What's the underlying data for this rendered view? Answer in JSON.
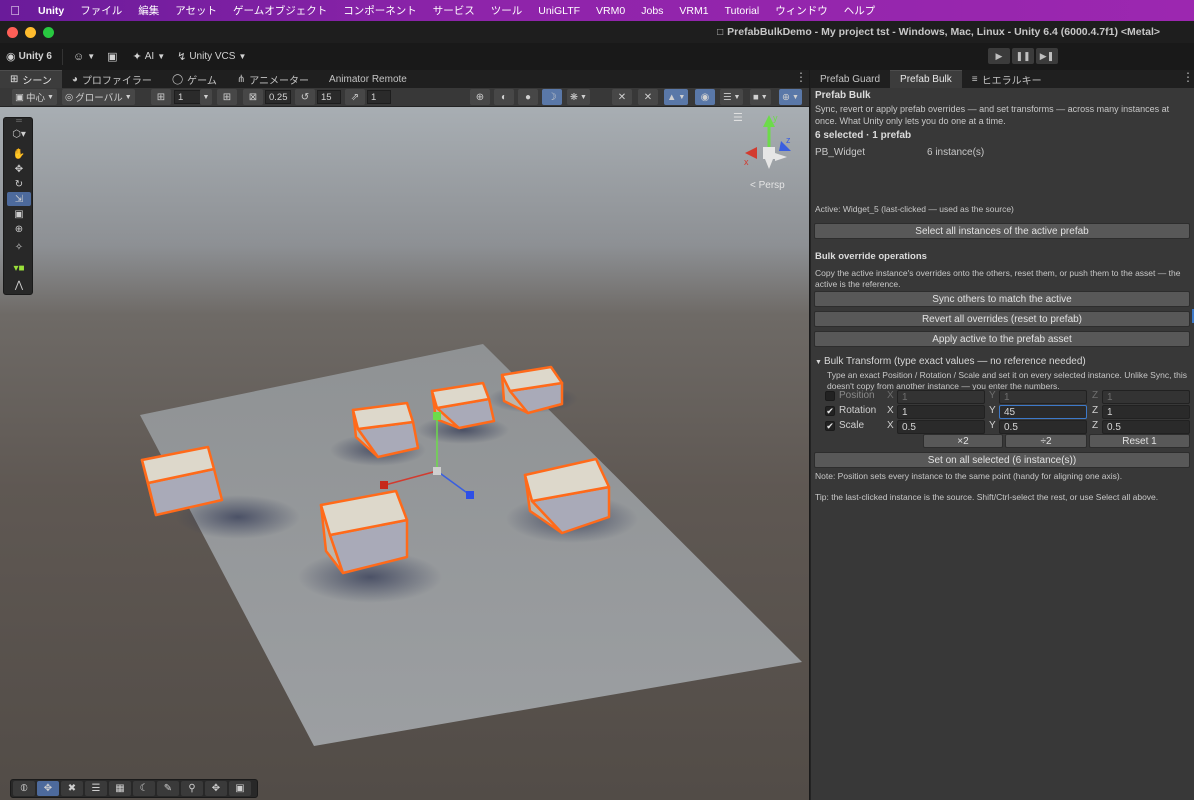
{
  "menubar": {
    "items": [
      "Unity",
      "ファイル",
      "編集",
      "アセット",
      "ゲームオブジェクト",
      "コンポーネント",
      "サービス",
      "ツール",
      "UniGLTF",
      "VRM0",
      "Jobs",
      "VRM1",
      "Tutorial",
      "ウィンドウ",
      "ヘルプ"
    ]
  },
  "window": {
    "title": "PrefabBulkDemo - My project tst - Windows, Mac, Linux - Unity 6.4 (6000.4.7f1) <Metal>"
  },
  "toolbar": {
    "account_label": "Unity 6",
    "ai_label": "AI",
    "vcs_label": "Unity VCS"
  },
  "scene_tabs": [
    "シーン",
    "プロファイラー",
    "ゲーム",
    "アニメーター",
    "Animator Remote"
  ],
  "panel_tabs": [
    "Prefab Guard",
    "Prefab Bulk",
    "ヒエラルキー"
  ],
  "scene_toolbar": {
    "pivot_label": "中心",
    "space_label": "グローバル",
    "grid_value": "1",
    "scale_snap": "0.25",
    "rotate_snap": "15",
    "increment_snap": "1"
  },
  "scene": {
    "persp_label": "< Persp",
    "gizmo_axes": {
      "x": "x",
      "y": "y",
      "z": "z"
    }
  },
  "panel": {
    "title": "Prefab Bulk",
    "description": "Sync, revert or apply prefab overrides — and set transforms — across many instances at once. What Unity only lets you do one at a time.",
    "selection_summary": "6 selected  ·  1 prefab",
    "prefab_row": {
      "name": "PB_Widget",
      "count": "6 instance(s)"
    },
    "active_note": "Active: Widget_5   (last-clicked — used as the source)",
    "select_all_button": "Select all instances of the active prefab",
    "overrides_heading": "Bulk override operations",
    "overrides_description": "Copy the active instance's overrides onto the others, reset them, or push them to the asset — the active is the reference.",
    "sync_button": "Sync others to match the active",
    "revert_button": "Revert all overrides  (reset to prefab)",
    "apply_button": "Apply active to the prefab asset",
    "bulk_transform_heading": "Bulk Transform  (type exact values — no reference needed)",
    "bulk_transform_description": "Type an exact Position / Rotation / Scale and set it on every selected instance. Unlike Sync, this doesn't copy from another instance — you enter the numbers.",
    "fields": [
      {
        "label": "Position",
        "checked": false,
        "x": "1",
        "y": "1",
        "z": "1"
      },
      {
        "label": "Rotation",
        "checked": true,
        "x": "1",
        "y": "45",
        "z": "1"
      },
      {
        "label": "Scale",
        "checked": true,
        "x": "0.5",
        "y": "0.5",
        "z": "0.5"
      }
    ],
    "axis_labels": {
      "x": "X",
      "y": "Y",
      "z": "Z"
    },
    "check_glyph": "✔",
    "scale_buttons": {
      "half": "×2",
      "double": "÷2",
      "reset": "Reset 1"
    },
    "set_button": "Set on all selected  (6 instance(s))",
    "note": "Note: Position sets every instance to the same point (handy for aligning one axis).",
    "tip": "Tip: the last-clicked instance is the source. Shift/Ctrl-select the rest, or use Select all above."
  },
  "colors": {
    "menubar": "#8e24aa",
    "selection_outline": "#ff6a1a",
    "accent": "#3d79c9"
  }
}
